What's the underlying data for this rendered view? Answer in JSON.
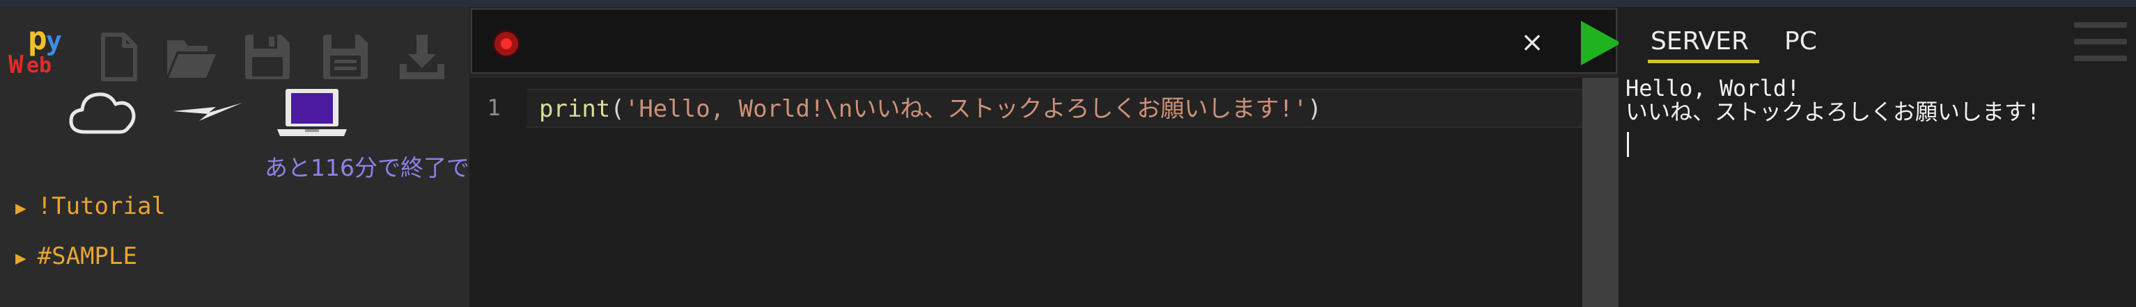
{
  "logo": {
    "p": "p",
    "y": "y",
    "w": "W",
    "eb": "eb"
  },
  "sidebar": {
    "remaining": "あと116分で終了で",
    "tree": [
      {
        "arrow": "▶",
        "label": "!Tutorial"
      },
      {
        "arrow": "▶",
        "label": "#SAMPLE"
      }
    ]
  },
  "toolbar_icons": [
    "new-file-icon",
    "open-folder-icon",
    "save-icon",
    "save-as-icon",
    "download-icon"
  ],
  "status_icons": [
    "cloud-icon",
    "lightning-icon",
    "laptop-icon"
  ],
  "editor": {
    "close_label": "×",
    "line_number": "1",
    "code_fn": "print",
    "code_open": "(",
    "code_string": "'Hello, World!\\nいいね、ストックよろしくお願いします!'",
    "code_close": ")"
  },
  "output": {
    "tabs": [
      "SERVER",
      "PC"
    ],
    "active_tab": "SERVER",
    "console_lines": [
      "Hello, World!",
      "いいね、ストックよろしくお願いします!"
    ]
  },
  "colors": {
    "accent_tab": "#d8c22c",
    "run_button": "#1fb31f",
    "record_button": "#ff2a2a",
    "tree_text": "#e9a52f",
    "remaining_text": "#8c82e8"
  }
}
